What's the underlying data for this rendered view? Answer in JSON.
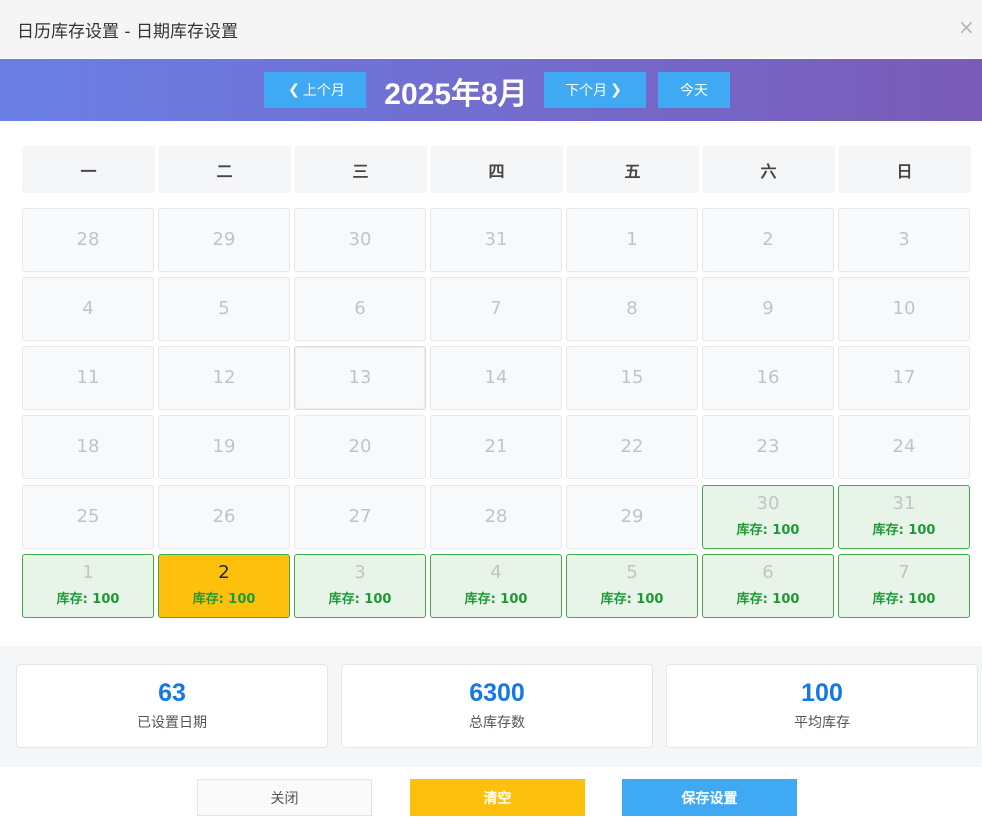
{
  "dialog": {
    "title": "日历库存设置 - 日期库存设置",
    "close_glyph": "×"
  },
  "nav": {
    "prev_label": "上个月",
    "next_label": "下个月",
    "today_label": "今天",
    "month_label": "2025年8月"
  },
  "weekdays": [
    "一",
    "二",
    "三",
    "四",
    "五",
    "六",
    "日"
  ],
  "stock_prefix": "库存: ",
  "weeks": [
    [
      {
        "day": "28"
      },
      {
        "day": "29"
      },
      {
        "day": "30"
      },
      {
        "day": "31"
      },
      {
        "day": "1"
      },
      {
        "day": "2"
      },
      {
        "day": "3"
      }
    ],
    [
      {
        "day": "4"
      },
      {
        "day": "5"
      },
      {
        "day": "6"
      },
      {
        "day": "7"
      },
      {
        "day": "8"
      },
      {
        "day": "9"
      },
      {
        "day": "10"
      }
    ],
    [
      {
        "day": "11"
      },
      {
        "day": "12"
      },
      {
        "day": "13",
        "today": true
      },
      {
        "day": "14"
      },
      {
        "day": "15"
      },
      {
        "day": "16"
      },
      {
        "day": "17"
      }
    ],
    [
      {
        "day": "18"
      },
      {
        "day": "19"
      },
      {
        "day": "20"
      },
      {
        "day": "21"
      },
      {
        "day": "22"
      },
      {
        "day": "23"
      },
      {
        "day": "24"
      }
    ],
    [
      {
        "day": "25"
      },
      {
        "day": "26"
      },
      {
        "day": "27"
      },
      {
        "day": "28"
      },
      {
        "day": "29"
      },
      {
        "day": "30",
        "stock": "100"
      },
      {
        "day": "31",
        "stock": "100"
      }
    ],
    [
      {
        "day": "1",
        "stock": "100"
      },
      {
        "day": "2",
        "stock": "100",
        "selected": true
      },
      {
        "day": "3",
        "stock": "100"
      },
      {
        "day": "4",
        "stock": "100"
      },
      {
        "day": "5",
        "stock": "100"
      },
      {
        "day": "6",
        "stock": "100"
      },
      {
        "day": "7",
        "stock": "100"
      }
    ]
  ],
  "stats": [
    {
      "value": "63",
      "label": "已设置日期"
    },
    {
      "value": "6300",
      "label": "总库存数"
    },
    {
      "value": "100",
      "label": "平均库存"
    }
  ],
  "footer": {
    "close_label": "关闭",
    "clear_label": "清空",
    "save_label": "保存设置"
  },
  "colors": {
    "set_border": "#3bab48",
    "selected_bg": "#fdc00c",
    "primary": "#40a9f3",
    "stat_value": "#1677e6"
  }
}
